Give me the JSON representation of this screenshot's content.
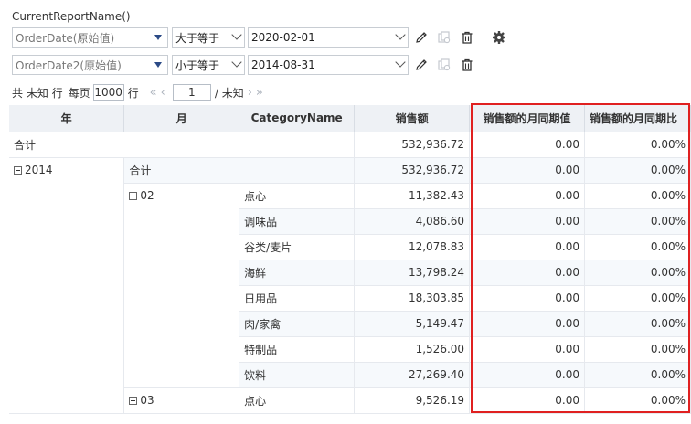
{
  "report_title": "CurrentReportName()",
  "filters": [
    {
      "field": "OrderDate(原始值)",
      "operator": "大于等于",
      "value": "2020-02-01",
      "has_settings": true
    },
    {
      "field": "OrderDate2(原始值)",
      "operator": "小于等于",
      "value": "2014-08-31",
      "has_settings": false
    }
  ],
  "pager": {
    "total_label": "共 未知 行",
    "per_page_label": "每页",
    "per_page_value": "1000",
    "rows_unit": "行",
    "first": "«",
    "prev": "‹",
    "page_value": "1",
    "page_total": "/ 未知",
    "next": "›",
    "last": "»"
  },
  "columns": [
    "年",
    "月",
    "CategoryName",
    "销售额",
    "销售额的月同期值",
    "销售额的月同期比"
  ],
  "rows": [
    {
      "year": "合计",
      "month": "",
      "category": "",
      "sales": "532,936.72",
      "prev_value": "0.00",
      "prev_ratio": "0.00%"
    },
    {
      "year": "2014",
      "month": "合计",
      "category": "",
      "sales": "532,936.72",
      "prev_value": "0.00",
      "prev_ratio": "0.00%"
    },
    {
      "year": "",
      "month": "02",
      "category": "点心",
      "sales": "11,382.43",
      "prev_value": "0.00",
      "prev_ratio": "0.00%"
    },
    {
      "year": "",
      "month": "",
      "category": "调味品",
      "sales": "4,086.60",
      "prev_value": "0.00",
      "prev_ratio": "0.00%"
    },
    {
      "year": "",
      "month": "",
      "category": "谷类/麦片",
      "sales": "12,078.83",
      "prev_value": "0.00",
      "prev_ratio": "0.00%"
    },
    {
      "year": "",
      "month": "",
      "category": "海鲜",
      "sales": "13,798.24",
      "prev_value": "0.00",
      "prev_ratio": "0.00%"
    },
    {
      "year": "",
      "month": "",
      "category": "日用品",
      "sales": "18,303.85",
      "prev_value": "0.00",
      "prev_ratio": "0.00%"
    },
    {
      "year": "",
      "month": "",
      "category": "肉/家禽",
      "sales": "5,149.47",
      "prev_value": "0.00",
      "prev_ratio": "0.00%"
    },
    {
      "year": "",
      "month": "",
      "category": "特制品",
      "sales": "1,526.00",
      "prev_value": "0.00",
      "prev_ratio": "0.00%"
    },
    {
      "year": "",
      "month": "",
      "category": "饮料",
      "sales": "27,269.40",
      "prev_value": "0.00",
      "prev_ratio": "0.00%"
    },
    {
      "year": "",
      "month": "03",
      "category": "点心",
      "sales": "9,526.19",
      "prev_value": "0.00",
      "prev_ratio": "0.00%"
    }
  ],
  "colors": {
    "highlight": "#e02020",
    "header_bg": "#eef1f5",
    "dropdown_arrow": "#2b4a86"
  },
  "icons": [
    "pencil-icon",
    "copy-icon",
    "trash-icon",
    "gear-icon",
    "collapse-icon"
  ]
}
